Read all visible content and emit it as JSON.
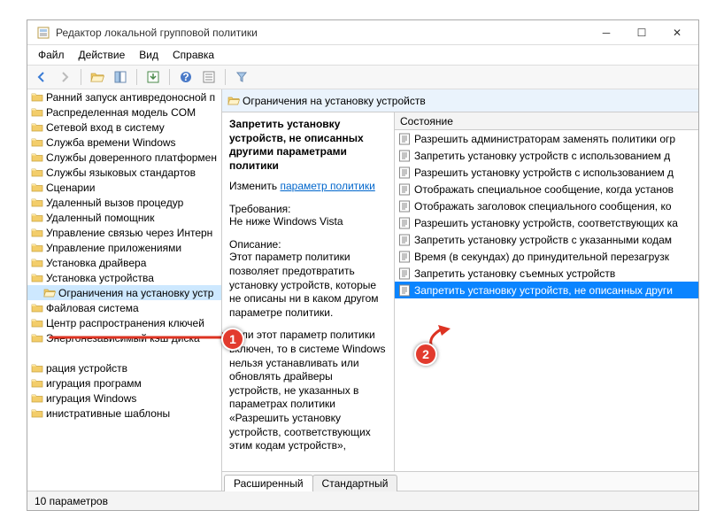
{
  "window": {
    "title": "Редактор локальной групповой политики"
  },
  "menu": {
    "file": "Файл",
    "action": "Действие",
    "view": "Вид",
    "help": "Справка"
  },
  "tree": {
    "items": [
      {
        "label": "Ранний запуск антивредоносной п",
        "level": 0
      },
      {
        "label": "Распределенная модель COM",
        "level": 0
      },
      {
        "label": "Сетевой вход в систему",
        "level": 0
      },
      {
        "label": "Служба времени Windows",
        "level": 0
      },
      {
        "label": "Службы доверенного платформен",
        "level": 0
      },
      {
        "label": "Службы языковых стандартов",
        "level": 0
      },
      {
        "label": "Сценарии",
        "level": 0
      },
      {
        "label": "Удаленный вызов процедур",
        "level": 0
      },
      {
        "label": "Удаленный помощник",
        "level": 0
      },
      {
        "label": "Управление связью через Интерн",
        "level": 0
      },
      {
        "label": "Управление приложениями",
        "level": 0
      },
      {
        "label": "Установка драйвера",
        "level": 0
      },
      {
        "label": "Установка устройства",
        "level": 0
      },
      {
        "label": "Ограничения на установку устр",
        "level": 1,
        "selected": true
      },
      {
        "label": "Файловая система",
        "level": 0
      },
      {
        "label": "Центр распространения ключей",
        "level": 0
      },
      {
        "label": "Энергонезависимый кэш диска",
        "level": 0
      },
      {
        "label": "",
        "level": 0,
        "blank": true
      },
      {
        "label": "рация устройств",
        "level": 0
      },
      {
        "label": "игурация программ",
        "level": 0
      },
      {
        "label": "игурация Windows",
        "level": 0
      },
      {
        "label": "инистративные шаблоны",
        "level": 0
      }
    ]
  },
  "path": {
    "label": "Ограничения на установку устройств"
  },
  "desc": {
    "title": "Запретить установку устройств, не описанных другими параметрами политики",
    "change_lbl": "Изменить",
    "change_link": "параметр политики",
    "req_lbl": "Требования:",
    "req_val": "Не ниже Windows Vista",
    "desc_lbl": "Описание:",
    "desc_p1": "Этот параметр политики позволяет предотвратить установку устройств, которые не описаны ни в каком другом параметре политики.",
    "desc_p2": "Если этот параметр политики включен, то в системе Windows нельзя устанавливать или обновлять драйверы устройств, не указанных в параметрах политики «Разрешить установку устройств, соответствующих этим кодам устройств»,"
  },
  "list": {
    "col_state": "Состояние",
    "items": [
      {
        "label": "Разрешить администраторам заменять политики огр"
      },
      {
        "label": "Запретить установку устройств с использованием д"
      },
      {
        "label": "Разрешить установку устройств с использованием д"
      },
      {
        "label": "Отображать специальное сообщение, когда установ"
      },
      {
        "label": "Отображать заголовок специального сообщения, ко"
      },
      {
        "label": "Разрешить установку устройств, соответствующих ка"
      },
      {
        "label": "Запретить установку устройств с указанными кодам"
      },
      {
        "label": "Время (в секундах) до принудительной перезагрузк"
      },
      {
        "label": "Запретить установку съемных устройств"
      },
      {
        "label": "Запретить установку устройств, не описанных други",
        "selected": true
      }
    ]
  },
  "tabs": {
    "ext": "Расширенный",
    "std": "Стандартный"
  },
  "status": {
    "text": "10 параметров"
  }
}
